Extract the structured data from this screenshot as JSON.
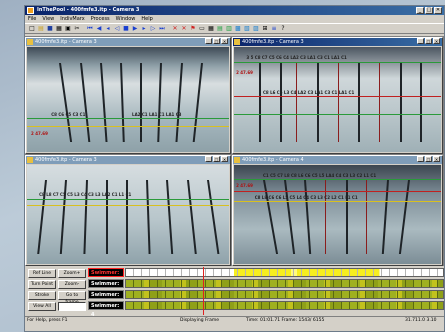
{
  "window": {
    "title": "InThePool - 400fmfe3.itp - Camera 3",
    "controls": [
      "_",
      "□",
      "✕"
    ]
  },
  "menu": [
    "File",
    "View",
    "IndivMarx",
    "Process",
    "Window",
    "Help"
  ],
  "toolbar_icons": [
    "new-icon",
    "open-icon",
    "save-icon",
    "print-icon",
    "film-icon",
    "cut-icon",
    "first-frame-icon",
    "prev-icon",
    "back-icon",
    "play-back-icon",
    "stop-icon",
    "play-icon",
    "forward-icon",
    "next-icon",
    "last-frame-icon",
    "mark-x-icon",
    "mark-x2-icon",
    "flag-icon",
    "camera-icon",
    "grid-icon",
    "lane-icon",
    "zoom-icon",
    "help-icon"
  ],
  "views": [
    {
      "title": "400fmfe3.itp - Camera 3",
      "labels_left": "C8  C6  C5  C3  C1",
      "labels_right": "LA2 C1  LA1 C1  LA1 C3",
      "scale": "2 47.69"
    },
    {
      "title": "400fmfe3.itp - Camera 3",
      "labels_top": "3 5  C8 C7 C5 C6 C4  LA2 C3  LA1 C3 C1  LA1 C1",
      "labels_mid": "C8 L6 C5 L3 C4  LA2 C3  LA1 C3 C1 LA1 C1",
      "scale": "2 47.69"
    },
    {
      "title": "400fmfe3.itp - Camera 3",
      "labels_mid": "C8 L8 C7 C5 C5 L3 C4 C3 L3 LA2 C1 L1 C1"
    },
    {
      "title": "400fmfe3.itp - Camera 4",
      "labels_top": "C1 C5 C7 L8 C8 L6 C6 C5 L5 LA4 C4 C3 L3 C2 L1 C1",
      "labels_mid": "C8 L8 C6 C6 L5 C5 L4 C4 C3 L3 C2 L2 C1 L1 C1",
      "scale": "2 47.69"
    }
  ],
  "buttons": {
    "ref_line": "Ref Line",
    "zoom_plus": "Zoom+",
    "turn_point": "Turn Point",
    "zoom_minus": "Zoom-",
    "stroke": "Stroke",
    "go_to_frame": "Go to frame",
    "view_all": "View All"
  },
  "swimmers": [
    {
      "label": "Swimmer: 1"
    },
    {
      "label": "Swimmer: 2"
    },
    {
      "label": "Swimmer: 3"
    },
    {
      "label": "Swimmer: 4"
    }
  ],
  "status": {
    "help": "For Help, press F1",
    "mode": "Displaying Frame",
    "time_frame": "Time: 01:01.71   Frame: 1543/ 6155",
    "extra": "31.711.0   3.10"
  },
  "colors": {
    "titlebar": "#0a246a",
    "track_yellow": "#f6ee20",
    "track_green": "#9fb020",
    "swimmer_active": "#ff3030"
  }
}
